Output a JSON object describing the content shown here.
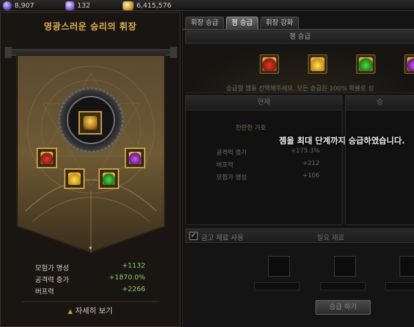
{
  "currency": [
    {
      "name": "crystal-icon",
      "value": "8,907"
    },
    {
      "name": "box-icon",
      "value": "132"
    },
    {
      "name": "gold-icon",
      "value": "6,415,576"
    }
  ],
  "left": {
    "title": "영광스러운 승리의 휘장",
    "stats": [
      {
        "label": "모험가 명성",
        "value": "+1132"
      },
      {
        "label": "공격력 증가",
        "value": "+1870.0%"
      },
      {
        "label": "버프력",
        "value": "+2266"
      }
    ],
    "detail_button": "자세히 보기"
  },
  "tabs": [
    {
      "label": "휘장 승급",
      "active": false
    },
    {
      "label": "젬 승급",
      "active": true
    },
    {
      "label": "휘장 강화",
      "active": false
    }
  ],
  "panel": {
    "header": "젬 승급",
    "instruction": "승급할 젬을 선택해주세요. 모든 승급은 100% 확률로 성",
    "col_current": "현재",
    "col_next": "승",
    "gem_name_partial": "찬란한 가호",
    "message": "젬을 최대 단계까지 승급하였습니다.",
    "substats": [
      {
        "label": "공격력 증가",
        "value": "+175.3%"
      },
      {
        "label": "버프력",
        "value": "+212"
      },
      {
        "label": "모험가 명성",
        "value": "+106"
      }
    ],
    "material_checkbox": "금고 재료 사용",
    "material_header": "필요 재료",
    "upgrade_button": "승급 하기"
  },
  "colors": {
    "title_gold": "#e2b24e",
    "stat_green": "#8fce6a"
  }
}
